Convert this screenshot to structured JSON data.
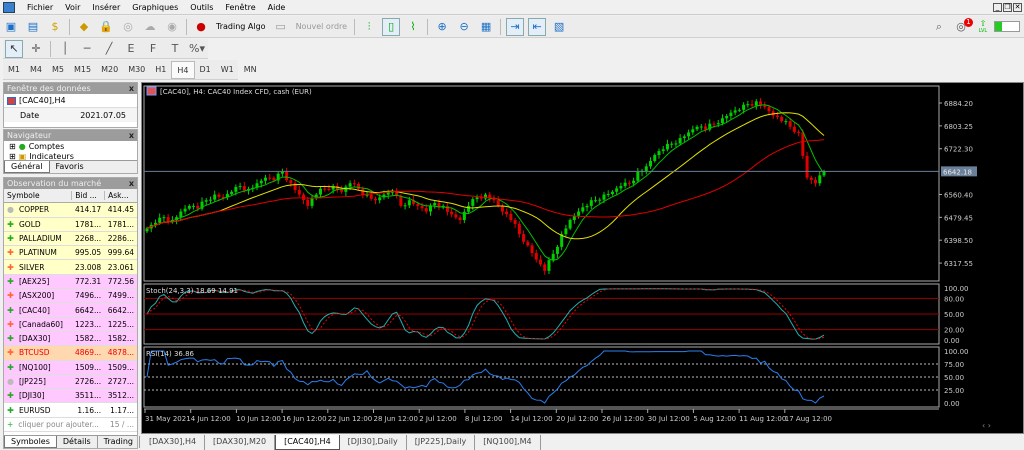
{
  "menu": [
    "Fichier",
    "Voir",
    "Insérer",
    "Graphiques",
    "Outils",
    "Fenêtre",
    "Aide"
  ],
  "toolbar": {
    "trading_algo": "Trading Algo",
    "new_order": "Nouvel ordre",
    "notification_count": "1",
    "lvl": "LVL"
  },
  "timeframes": [
    "M1",
    "M4",
    "M5",
    "M15",
    "M20",
    "M30",
    "H1",
    "H4",
    "D1",
    "W1",
    "MN"
  ],
  "active_timeframe": "H4",
  "data_window": {
    "title": "Fenêtre des données",
    "symbol": "[CAC40],H4",
    "date_label": "Date",
    "date_value": "2021.07.05"
  },
  "navigator": {
    "title": "Navigateur",
    "items": [
      "Comptes",
      "Indicateurs"
    ],
    "tabs": [
      "Général",
      "Favoris"
    ]
  },
  "market_watch": {
    "title": "Observation du marché",
    "headers": [
      "Symbole",
      "Bid ...",
      "Ask..."
    ],
    "rows": [
      {
        "symbol": "COPPER",
        "bid": "414.17",
        "ask": "414.45",
        "dir": "neutral",
        "bg": "#ffffc8"
      },
      {
        "symbol": "GOLD",
        "bid": "1781...",
        "ask": "1781...",
        "dir": "up",
        "bg": "#ffffc8"
      },
      {
        "symbol": "PALLADIUM",
        "bid": "2268...",
        "ask": "2286...",
        "dir": "up",
        "bg": "#ffffc8"
      },
      {
        "symbol": "PLATINUM",
        "bid": "995.05",
        "ask": "999.64",
        "dir": "down",
        "bg": "#ffffc8"
      },
      {
        "symbol": "SILVER",
        "bid": "23.008",
        "ask": "23.061",
        "dir": "down",
        "bg": "#ffffc8"
      },
      {
        "symbol": "[AEX25]",
        "bid": "772.31",
        "ask": "772.56",
        "dir": "up",
        "bg": "#ffc8ff"
      },
      {
        "symbol": "[ASX200]",
        "bid": "7496...",
        "ask": "7499...",
        "dir": "down",
        "bg": "#ffc8ff"
      },
      {
        "symbol": "[CAC40]",
        "bid": "6642...",
        "ask": "6642...",
        "dir": "up",
        "bg": "#ffc8ff"
      },
      {
        "symbol": "[Canada60]",
        "bid": "1223...",
        "ask": "1225...",
        "dir": "down",
        "bg": "#ffc8ff"
      },
      {
        "symbol": "[DAX30]",
        "bid": "1582...",
        "ask": "1582...",
        "dir": "up",
        "bg": "#ffc8ff"
      },
      {
        "symbol": "BTCUSD",
        "bid": "4869...",
        "ask": "4878...",
        "dir": "down",
        "bg": "#ffd8b0",
        "red": true
      },
      {
        "symbol": "[NQ100]",
        "bid": "1509...",
        "ask": "1509...",
        "dir": "up",
        "bg": "#ffc8ff"
      },
      {
        "symbol": "[JP225]",
        "bid": "2726...",
        "ask": "2727...",
        "dir": "neutral",
        "bg": "#ffc8ff"
      },
      {
        "symbol": "[DJI30]",
        "bid": "3511...",
        "ask": "3512...",
        "dir": "up",
        "bg": "#ffc8ff"
      },
      {
        "symbol": "EURUSD",
        "bid": "1.16...",
        "ask": "1.17...",
        "dir": "up",
        "bg": "#ffffff"
      }
    ],
    "add_label": "cliquer pour ajouter...",
    "count": "15 / ...",
    "tabs": [
      "Symboles",
      "Détails",
      "Trading"
    ]
  },
  "chart_tabs": [
    "[DAX30],H4",
    "[DAX30],M20",
    "[CAC40],H4",
    "[DJI30],Daily",
    "[JP225],Daily",
    "[NQ100],M4"
  ],
  "active_chart_tab": "[CAC40],H4",
  "chart_data": {
    "type": "candlestick",
    "title": "[CAC40], H4:  CAC40 Index CFD, cash (EUR)",
    "price_ticks": [
      "6884.20",
      "6803.25",
      "6722.30",
      "6560.40",
      "6479.45",
      "6398.50",
      "6317.55"
    ],
    "price_tick_values": [
      6884.2,
      6803.25,
      6722.3,
      6560.4,
      6479.45,
      6398.5,
      6317.55
    ],
    "current_price": "6642.18",
    "current_price_value": 6642.18,
    "x_labels": [
      "31 May 2021",
      "4 Jun 12:00",
      "10 Jun 12:00",
      "16 Jun 12:00",
      "22 Jun 12:00",
      "28 Jun 12:00",
      "2 Jul 12:00",
      "8 Jul 12:00",
      "14 Jul 12:00",
      "20 Jul 12:00",
      "26 Jul 12:00",
      "30 Jul 12:00",
      "5 Aug 12:00",
      "11 Aug 12:00",
      "17 Aug 12:00"
    ],
    "closes": [
      6440,
      6460,
      6480,
      6470,
      6500,
      6520,
      6510,
      6540,
      6560,
      6550,
      6570,
      6590,
      6580,
      6600,
      6620,
      6610,
      6640,
      6600,
      6560,
      6520,
      6560,
      6580,
      6590,
      6570,
      6600,
      6580,
      6560,
      6540,
      6560,
      6570,
      6520,
      6540,
      6520,
      6500,
      6530,
      6520,
      6490,
      6470,
      6520,
      6550,
      6560,
      6540,
      6500,
      6470,
      6420,
      6380,
      6330,
      6290,
      6350,
      6420,
      6470,
      6500,
      6520,
      6540,
      6560,
      6570,
      6590,
      6600,
      6640,
      6660,
      6700,
      6720,
      6740,
      6760,
      6780,
      6800,
      6790,
      6810,
      6830,
      6850,
      6860,
      6880,
      6890,
      6870,
      6840,
      6820,
      6800,
      6780,
      6620,
      6600,
      6642
    ],
    "ma_colors": {
      "fast": "#00c000",
      "mid": "#e0e000",
      "slow": "#e00000"
    },
    "stoch": {
      "label": "Stoch(24,3,3) 18.69 14.91",
      "ticks": [
        "100.00",
        "80.00",
        "50.00",
        "20.00",
        "0.00"
      ],
      "levels": [
        80,
        50,
        20
      ]
    },
    "rsi": {
      "label": "RSI(14) 36.86",
      "ticks": [
        "100.00",
        "75.00",
        "50.00",
        "25.00",
        "0.00"
      ],
      "levels": [
        75,
        50,
        25
      ]
    }
  }
}
